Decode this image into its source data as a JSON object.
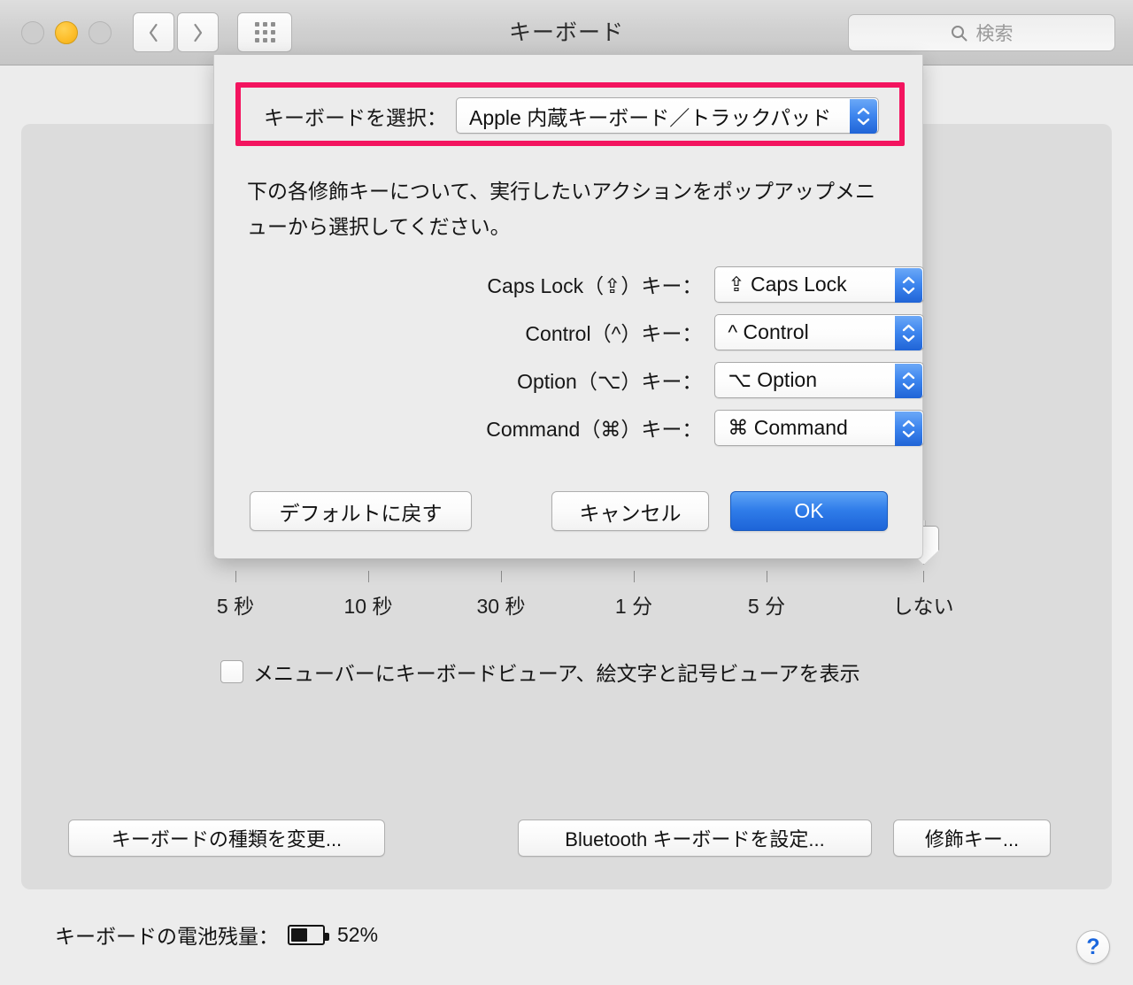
{
  "window": {
    "title": "キーボード",
    "traffic_lights": [
      "close",
      "minimize",
      "zoom"
    ]
  },
  "toolbar": {
    "back_icon": "chevron-left-icon",
    "forward_icon": "chevron-right-icon",
    "show_all_icon": "grid-icon",
    "search_placeholder": "検索",
    "search_value": "",
    "search_icon": "search-icon"
  },
  "sheet": {
    "keyboard_select": {
      "label": "キーボードを選択：",
      "value": "Apple 内蔵キーボード／トラックパッド",
      "highlighted": true,
      "highlight_color": "#f3145f"
    },
    "description": "下の各修飾キーについて、実行したいアクションをポップアップメニューから選択してください。",
    "modifier_rows": [
      {
        "label": "Caps Lock（⇪）キー：",
        "value": "⇪ Caps Lock"
      },
      {
        "label": "Control（^）キー：",
        "value": "^ Control"
      },
      {
        "label": "Option（⌥）キー：",
        "value": "⌥ Option"
      },
      {
        "label": "Command（⌘）キー：",
        "value": "⌘ Command"
      }
    ],
    "buttons": {
      "restore_defaults": "デフォルトに戻す",
      "cancel": "キャンセル",
      "ok": "OK"
    }
  },
  "background": {
    "slider": {
      "tick_labels": [
        "5 秒",
        "10 秒",
        "30 秒",
        "1 分",
        "5 分",
        "しない"
      ],
      "value": "しない",
      "thumb_position_percent": 100
    },
    "show_viewers_checkbox": {
      "label": "メニューバーにキーボードビューア、絵文字と記号ビューアを表示",
      "checked": false
    },
    "buttons": {
      "change_keyboard_type": "キーボードの種類を変更...",
      "bluetooth_setup": "Bluetooth キーボードを設定...",
      "modifier_keys": "修飾キー..."
    },
    "battery": {
      "label": "キーボードの電池残量：",
      "percent_text": "52%",
      "percent_value": 52
    },
    "help_button": "?"
  }
}
